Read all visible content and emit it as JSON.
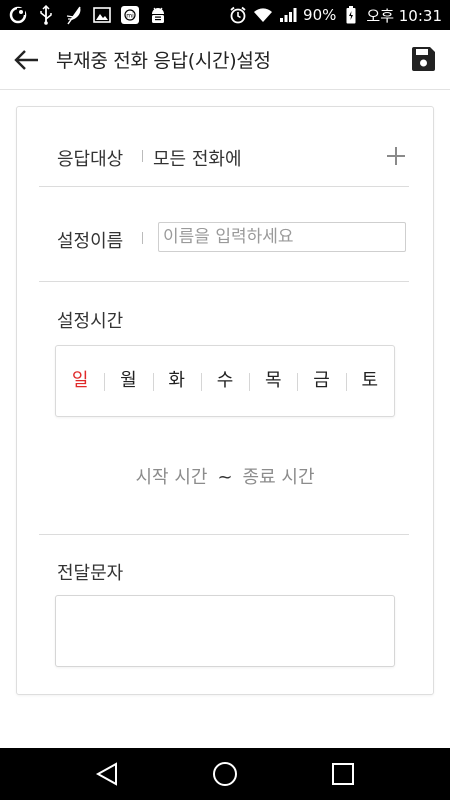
{
  "status_bar": {
    "battery": "90%",
    "time": "오후 10:31",
    "left_icons": [
      "app-icon",
      "usb-icon",
      "feather-icon",
      "image-icon",
      "mi-icon",
      "android-debug-icon"
    ],
    "right_icons": [
      "alarm-icon",
      "wifi-icon",
      "signal-icon",
      "battery-icon"
    ]
  },
  "header": {
    "title": "부재중 전화 응답(시간)설정",
    "back_icon": "arrow-left-icon",
    "save_icon": "save-icon"
  },
  "form": {
    "target": {
      "label": "응답대상",
      "value": "모든 전화에",
      "add_icon": "plus-icon"
    },
    "name": {
      "label": "설정이름",
      "value": "",
      "placeholder": "이름을 입력하세요"
    },
    "schedule": {
      "label": "설정시간",
      "days": [
        "일",
        "월",
        "화",
        "수",
        "목",
        "금",
        "토"
      ],
      "start_time": "시작 시간",
      "separator": "~",
      "end_time": "종료 시간"
    },
    "message": {
      "label": "전달문자",
      "value": ""
    }
  },
  "colors": {
    "accent_sunday": "#e02a2a",
    "placeholder": "#9a9a9a",
    "divider": "#dcdcdc"
  },
  "nav_bar": {
    "icons": [
      "back-triangle-icon",
      "home-circle-icon",
      "recents-square-icon"
    ]
  }
}
